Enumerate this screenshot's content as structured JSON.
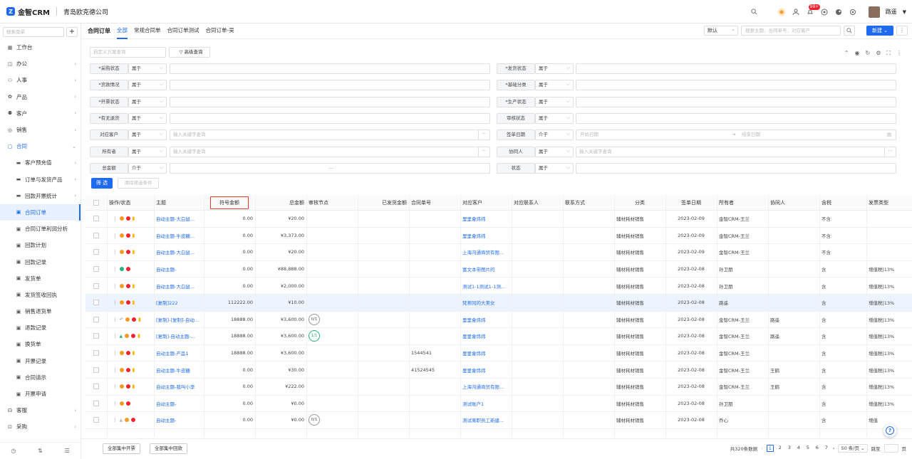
{
  "app": {
    "logo_text": "金智CRM",
    "company": "青岛欧克德公司",
    "badge": "99+",
    "username": "路遥"
  },
  "sidebar": {
    "search_placeholder": "搜索菜单",
    "items": [
      {
        "label": "工作台",
        "icon": "grid-icon",
        "sub": false
      },
      {
        "label": "办公",
        "icon": "office-icon",
        "sub": false,
        "arrow": true
      },
      {
        "label": "人事",
        "icon": "person-icon",
        "sub": false,
        "arrow": true
      },
      {
        "label": "产品",
        "icon": "product-icon",
        "sub": false,
        "arrow": true
      },
      {
        "label": "客户",
        "icon": "customer-icon",
        "sub": false,
        "arrow": true
      },
      {
        "label": "销售",
        "icon": "sales-icon",
        "sub": false,
        "arrow": true
      },
      {
        "label": "合同",
        "icon": "contract-icon",
        "sub": false,
        "arrow": true,
        "open": true
      },
      {
        "label": "客户预充值",
        "icon": "folder-icon",
        "sub": true,
        "arrow": true
      },
      {
        "label": "订单与发货产品",
        "icon": "folder-icon",
        "sub": true,
        "arrow": true
      },
      {
        "label": "回款开票统计",
        "icon": "folder-icon",
        "sub": true,
        "arrow": true
      },
      {
        "label": "合同订单",
        "icon": "doc-icon",
        "sub": true,
        "active": true
      },
      {
        "label": "合同订单利润分析",
        "icon": "doc-icon",
        "sub": true
      },
      {
        "label": "回款计划",
        "icon": "doc-icon",
        "sub": true
      },
      {
        "label": "回款记录",
        "icon": "doc-icon",
        "sub": true
      },
      {
        "label": "发货单",
        "icon": "doc-icon",
        "sub": true
      },
      {
        "label": "发货签收回执",
        "icon": "doc-icon",
        "sub": true
      },
      {
        "label": "销售退货单",
        "icon": "doc-icon",
        "sub": true
      },
      {
        "label": "退款记录",
        "icon": "doc-icon",
        "sub": true
      },
      {
        "label": "换货单",
        "icon": "doc-icon",
        "sub": true
      },
      {
        "label": "开票记录",
        "icon": "doc-icon",
        "sub": true
      },
      {
        "label": "合同请示",
        "icon": "doc-icon",
        "sub": true
      },
      {
        "label": "开票申请",
        "icon": "doc-icon",
        "sub": true
      },
      {
        "label": "客服",
        "icon": "service-icon",
        "sub": false,
        "arrow": true
      },
      {
        "label": "采购",
        "icon": "purchase-icon",
        "sub": false,
        "arrow": true
      }
    ]
  },
  "tabs": {
    "title": "合同订单",
    "items": [
      "全部",
      "常规合同单",
      "合同订单测试",
      "合同订单-吴"
    ],
    "active": 0
  },
  "toolbar": {
    "view_select": "默认",
    "search_placeholder": "搜索主题、合同单号、对应客户",
    "new_label": "新建 ⌄"
  },
  "filters": {
    "scheme_placeholder": "自定义方案查询",
    "advanced": "高级查询",
    "rows": [
      {
        "left": {
          "label": "*采购状态",
          "op": "属于"
        },
        "right": {
          "label": "*发货状态",
          "op": "属于"
        }
      },
      {
        "left": {
          "label": "*货款情况",
          "op": "属于"
        },
        "right": {
          "label": "*基础分类",
          "op": "属于"
        }
      },
      {
        "left": {
          "label": "*开票状态",
          "op": "属于"
        },
        "right": {
          "label": "*生产状态",
          "op": "属于"
        }
      },
      {
        "left": {
          "label": "*有无退货",
          "op": "属于"
        },
        "right": {
          "label": "审核状态",
          "op": "属于"
        }
      },
      {
        "left": {
          "label": "对应客户",
          "op": "属于",
          "ph": "输入关键字查询"
        },
        "right": {
          "label": "签单日期",
          "op": "介于",
          "start": "开始日期",
          "end": "结束日期"
        }
      },
      {
        "left": {
          "label": "所有者",
          "op": "属于",
          "ph": "输入关键字查询"
        },
        "right": {
          "label": "协同人",
          "op": "属于",
          "ph": "输入关键字查询"
        }
      },
      {
        "left": {
          "label": "总金额",
          "op": "介于",
          "mid": "—"
        },
        "right": {
          "label": "状态",
          "op": "属于"
        }
      }
    ],
    "filter_btn": "筛 选",
    "clear_btn": "清除筛选条件"
  },
  "table": {
    "columns": [
      "操作/状态",
      "主题",
      "符号金额",
      "总金额",
      "审核节点",
      "已发货金额",
      "合同单号",
      "对应客户",
      "对应联系人",
      "联系方式",
      "分类",
      "签单日期",
      "所有者",
      "协同人",
      "含税",
      "发票类型"
    ],
    "rows": [
      {
        "ops": [
          "o",
          "r",
          "y"
        ],
        "subject": "自动主题-大白鼠...",
        "sym": "0.00",
        "total": "¥20.00",
        "node": "",
        "no": "",
        "cust": "里里會炜炜",
        "cat": "辅材耗材销售",
        "date": "2023-02-09",
        "owner": "金智CRM-王兰",
        "co": "",
        "tax": "不含",
        "inv": ""
      },
      {
        "ops": [
          "o",
          "r",
          "y"
        ],
        "subject": "自动主题-牛皮糖...",
        "sym": "0.00",
        "total": "¥3,373.00",
        "node": "",
        "no": "",
        "cust": "里里會炜炜",
        "cat": "辅材耗材销售",
        "date": "2023-02-09",
        "owner": "金智CRM-王兰",
        "co": "",
        "tax": "不含",
        "inv": ""
      },
      {
        "ops": [
          "o",
          "r",
          "y"
        ],
        "subject": "自动主题-大白鼠...",
        "sym": "0.00",
        "total": "¥20.00",
        "node": "",
        "no": "",
        "cust": "上海沟通商贸有限...",
        "cat": "辅材耗材销售",
        "date": "2023-02-09",
        "owner": "金智CRM-王兰",
        "co": "",
        "tax": "不含",
        "inv": ""
      },
      {
        "ops": [
          "g",
          "r"
        ],
        "subject": "自动主题-",
        "sym": "0.00",
        "total": "¥88,888.00",
        "node": "",
        "no": "",
        "cust": "富文本带图片的",
        "cat": "辅材耗材销售",
        "date": "2023-02-08",
        "owner": "孙卫朋",
        "co": "",
        "tax": "含",
        "inv": "增值税|13%"
      },
      {
        "ops": [
          "o",
          "r",
          "y"
        ],
        "subject": "自动主题-大白鼠...",
        "sym": "0.00",
        "total": "¥2,000.00",
        "node": "",
        "no": "",
        "cust": "测试1-1测试1-1测...",
        "cat": "辅材耗材销售",
        "date": "2023-02-08",
        "owner": "孙卫朋",
        "co": "",
        "tax": "含",
        "inv": "增值税|13%"
      },
      {
        "ops": [
          "o",
          "r",
          "y"
        ],
        "subject": "[复制]222",
        "sym": "112222.00",
        "total": "¥10.00",
        "node": "",
        "no": "",
        "cust": "梵蒂冈的大美女",
        "cat": "辅材耗材销售",
        "date": "2023-02-08",
        "owner": "路遥",
        "co": "",
        "tax": "含",
        "inv": "增值税|13%",
        "hl": true
      },
      {
        "ops": [
          "u",
          "o",
          "r",
          "y"
        ],
        "subject": "[复制]-[复制]-自动...",
        "sym": "18888.00",
        "total": "¥3,600.00",
        "node": "0/1",
        "no": "",
        "cust": "里里會炜炜",
        "cat": "辅材耗材销售",
        "date": "2023-02-08",
        "owner": "金智CRM-王兰",
        "co": "路遥",
        "tax": "含",
        "inv": "增值税|13%"
      },
      {
        "ops": [
          "t",
          "o",
          "r",
          "y"
        ],
        "subject": "[复制]-自动主题-...",
        "sym": "18888.00",
        "total": "¥3,600.00",
        "node": "1/1",
        "nodeGreen": true,
        "no": "",
        "cust": "里里會炜炜",
        "cat": "辅材耗材销售",
        "date": "2023-02-08",
        "owner": "金智CRM-王兰",
        "co": "路遥",
        "tax": "含",
        "inv": "增值税|13%"
      },
      {
        "ops": [
          "o",
          "r",
          "y"
        ],
        "subject": "自动主题-产品1",
        "sym": "18888.00",
        "total": "¥3,600.00",
        "node": "",
        "no": "1544541",
        "cust": "里里會炜炜",
        "cat": "辅材耗材销售",
        "date": "2023-02-08",
        "owner": "金智CRM-王兰",
        "co": "",
        "tax": "含",
        "inv": "增值税|13%"
      },
      {
        "ops": [
          "o",
          "r",
          "y"
        ],
        "subject": "自动主题-牛皮糖",
        "sym": "0.00",
        "total": "¥30.00",
        "node": "",
        "no": "41524545",
        "cust": "里里會炜炜",
        "cat": "辅材耗材销售",
        "date": "2023-02-08",
        "owner": "金智CRM-王兰",
        "co": "王鹤",
        "tax": "含",
        "inv": "增值税|13%"
      },
      {
        "ops": [
          "o",
          "r",
          "y"
        ],
        "subject": "自动主题-我叫小李",
        "sym": "0.00",
        "total": "¥222.00",
        "node": "",
        "no": "",
        "cust": "上海沟通商贸有限...",
        "cat": "辅材耗材销售",
        "date": "2023-02-08",
        "owner": "金智CRM-王兰",
        "co": "王鹤",
        "tax": "含",
        "inv": "增值税|13%"
      },
      {
        "ops": [
          "o",
          "r"
        ],
        "subject": "自动主题-",
        "sym": "0.00",
        "total": "¥0.00",
        "node": "",
        "no": "",
        "cust": "测试账户1",
        "cat": "辅材耗材销售",
        "date": "2023-02-08",
        "owner": "孙卫朋",
        "co": "",
        "tax": "含",
        "inv": "增值税|13%"
      },
      {
        "ops": [
          "t2",
          "o",
          "r"
        ],
        "subject": "自动主题-",
        "sym": "0.00",
        "total": "¥0.00",
        "node": "0/1",
        "no": "",
        "cust": "测试离职员工新建...",
        "cat": "辅材耗材销售",
        "date": "2023-02-08",
        "owner": "乔心",
        "co": "",
        "tax": "含",
        "inv": "增值"
      }
    ]
  },
  "footer": {
    "btn1": "全部集中开票",
    "btn2": "全部集中回款",
    "total": "共320条数据",
    "pages": [
      "1",
      "2",
      "3",
      "4",
      "5",
      "6",
      "7"
    ],
    "page_size": "50 条/页 ⌄",
    "jump_label": "跳至",
    "page_suffix": "页"
  },
  "colors": {
    "accent": "#1e6bf0",
    "orange": "#f59a23",
    "red": "#f5222d",
    "yellow": "#f7b500",
    "green": "#2ab17a"
  }
}
